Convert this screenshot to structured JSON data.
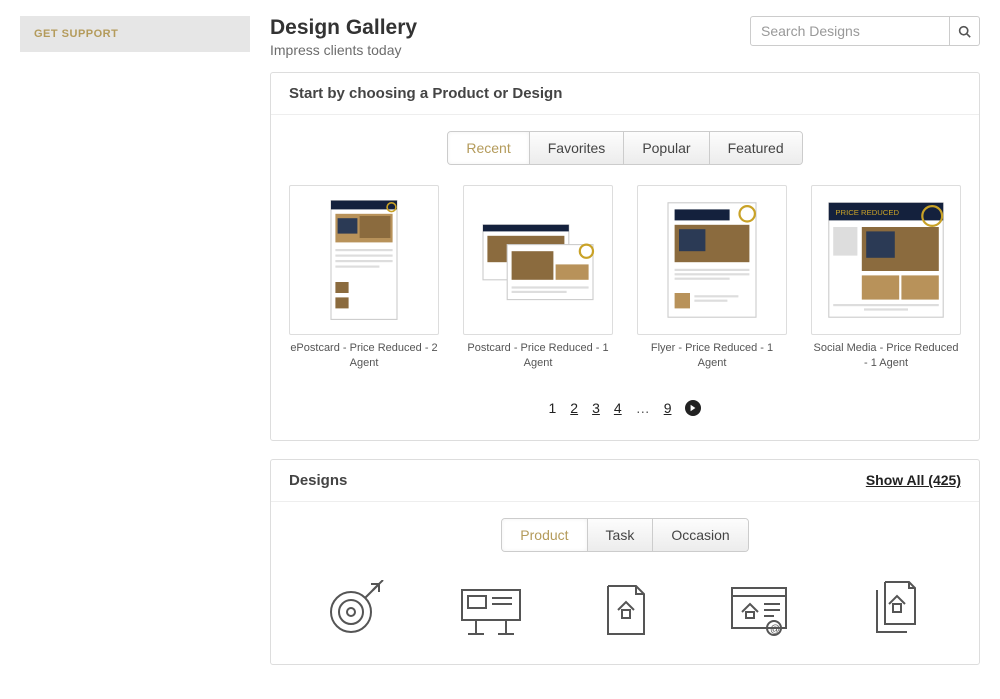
{
  "sidebar": {
    "support_label": "GET SUPPORT"
  },
  "header": {
    "title": "Design Gallery",
    "subtitle": "Impress clients today",
    "search_placeholder": "Search Designs"
  },
  "choose_panel": {
    "title": "Start by choosing a Product or Design",
    "tabs": [
      "Recent",
      "Favorites",
      "Popular",
      "Featured"
    ],
    "active_tab": 0,
    "items": [
      {
        "label": "ePostcard - Price Reduced - 2 Agent"
      },
      {
        "label": "Postcard - Price Reduced - 1 Agent"
      },
      {
        "label": "Flyer - Price Reduced - 1 Agent"
      },
      {
        "label": "Social Media - Price Reduced - 1 Agent"
      }
    ],
    "pages": [
      "1",
      "2",
      "3",
      "4",
      "…",
      "9"
    ],
    "current_page": "1"
  },
  "designs_panel": {
    "title": "Designs",
    "show_all": "Show All (425)",
    "tabs": [
      "Product",
      "Task",
      "Occasion"
    ],
    "active_tab": 0,
    "categories": [
      "target",
      "billboard",
      "document",
      "email-doc",
      "documents"
    ]
  }
}
